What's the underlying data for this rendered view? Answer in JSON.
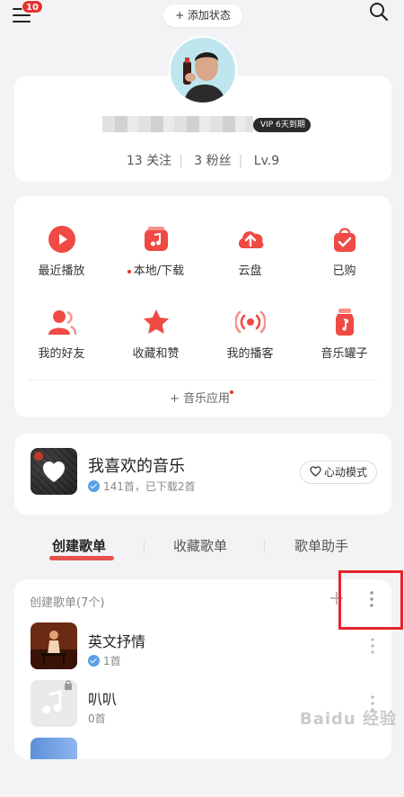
{
  "header": {
    "badge_count": "10",
    "status_button": "+ 添加状态"
  },
  "profile": {
    "vip_label": "VIP 6天到期",
    "stats": [
      "13 关注",
      "3 粉丝",
      "Lv.9"
    ]
  },
  "shortcuts": [
    {
      "label": "最近播放",
      "icon": "play-circle-icon"
    },
    {
      "label": "本地/下载",
      "icon": "music-note-box-icon",
      "dot": true
    },
    {
      "label": "云盘",
      "icon": "cloud-upload-icon"
    },
    {
      "label": "已购",
      "icon": "shopping-bag-icon"
    },
    {
      "label": "我的好友",
      "icon": "friends-icon"
    },
    {
      "label": "收藏和赞",
      "icon": "star-icon"
    },
    {
      "label": "我的播客",
      "icon": "broadcast-icon"
    },
    {
      "label": "音乐罐子",
      "icon": "music-jar-icon"
    }
  ],
  "music_apps": "+ 音乐应用",
  "favorites": {
    "title": "我喜欢的音乐",
    "subtitle": "141首，已下载2首",
    "heart_mode": "心动模式"
  },
  "tabs": [
    "创建歌单",
    "收藏歌单",
    "歌单助手"
  ],
  "playlist_section": {
    "header": "创建歌单(7个)",
    "items": [
      {
        "name": "英文抒情",
        "count": "1首",
        "verified": true
      },
      {
        "name": "叭叭",
        "count": "0首",
        "verified": false
      }
    ]
  },
  "watermark": "Baidu 经验",
  "colors": {
    "accent": "#e5342f",
    "background": "#f3f3f5",
    "highlight_box": "#e5242b"
  }
}
